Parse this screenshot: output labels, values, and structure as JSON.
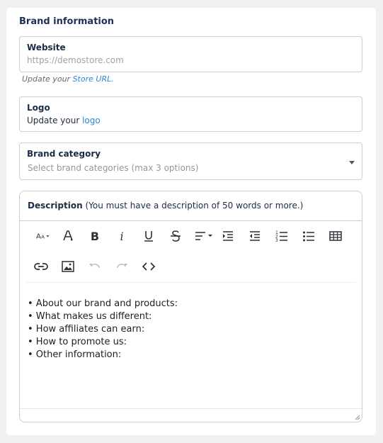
{
  "section_title": "Brand information",
  "website": {
    "label": "Website",
    "placeholder": "https://demostore.com",
    "hint_prefix": "Update your ",
    "hint_link": "Store URL."
  },
  "logo": {
    "label": "Logo",
    "text_prefix": "Update your ",
    "link": "logo"
  },
  "category": {
    "label": "Brand category",
    "placeholder": "Select brand categories (max 3 options)"
  },
  "description": {
    "label": "Description",
    "note": "(You must have a description of 50 words or more.)",
    "toolbar": [
      {
        "icon": "font-size-icon",
        "disabled": false
      },
      {
        "icon": "text-color-icon",
        "disabled": false
      },
      {
        "icon": "bold-icon",
        "disabled": false
      },
      {
        "icon": "italic-icon",
        "disabled": false
      },
      {
        "icon": "underline-icon",
        "disabled": false
      },
      {
        "icon": "strikethrough-icon",
        "disabled": false
      },
      {
        "icon": "align-icon",
        "disabled": false
      },
      {
        "icon": "indent-icon",
        "disabled": false
      },
      {
        "icon": "outdent-icon",
        "disabled": false
      },
      {
        "icon": "ordered-list-icon",
        "disabled": false
      },
      {
        "icon": "bullet-list-icon",
        "disabled": false
      },
      {
        "icon": "table-icon",
        "disabled": false
      },
      {
        "icon": "link-icon",
        "disabled": false
      },
      {
        "icon": "image-icon",
        "disabled": false
      },
      {
        "icon": "undo-icon",
        "disabled": true
      },
      {
        "icon": "redo-icon",
        "disabled": true
      },
      {
        "icon": "code-icon",
        "disabled": false
      }
    ],
    "content_lines": [
      "• About our brand and products:",
      "• What makes us different:",
      "• How affiliates can earn:",
      "• How to promote us:",
      "• Other information:"
    ]
  },
  "colors": {
    "accent_link": "#2e86d1",
    "title": "#1b3257",
    "border": "#c9cfd6",
    "disabled_icon": "#b8bcc2"
  }
}
